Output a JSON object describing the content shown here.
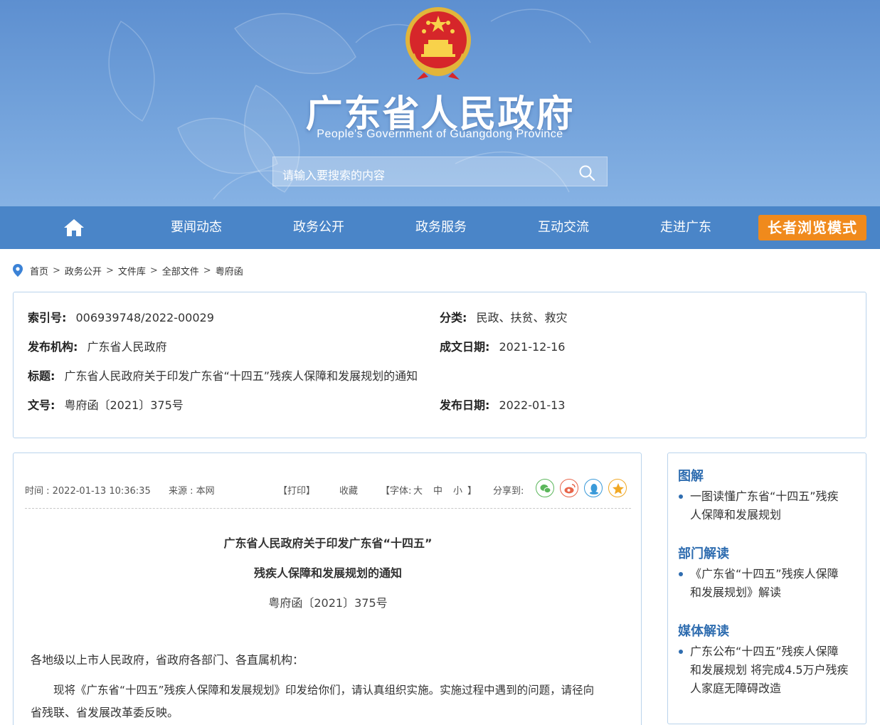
{
  "header": {
    "title": "广东省人民政府",
    "subtitle": "People's Government of Guangdong Province",
    "search_placeholder": "请输入要搜索的内容"
  },
  "nav": {
    "items": [
      "要闻动态",
      "政务公开",
      "政务服务",
      "互动交流",
      "走进广东"
    ],
    "elder_mode": "长者浏览模式"
  },
  "breadcrumb": [
    "首页",
    "政务公开",
    "文件库",
    "全部文件",
    "粤府函"
  ],
  "meta": {
    "index_label": "索引号:",
    "index_value": "006939748/2022-00029",
    "category_label": "分类:",
    "category_value": "民政、扶贫、救灾",
    "publisher_label": "发布机构:",
    "publisher_value": "广东省人民政府",
    "date_written_label": "成文日期:",
    "date_written_value": "2021-12-16",
    "title_label": "标题:",
    "title_value": "广东省人民政府关于印发广东省“十四五”残疾人保障和发展规划的通知",
    "docno_label": "文号:",
    "docno_value": "粤府函〔2021〕375号",
    "publish_date_label": "发布日期:",
    "publish_date_value": "2022-01-13"
  },
  "article": {
    "time": "时间 : 2022-01-13 10:36:35",
    "source": "来源 : 本网",
    "print": "【打印】",
    "favorite": "收藏",
    "font_size_label": "【字体:",
    "font_large": "大",
    "font_medium": "中",
    "font_small": "小",
    "font_close": "】",
    "share_label": "分享到:",
    "title_line1": "广东省人民政府关于印发广东省“十四五”",
    "title_line2": "残疾人保障和发展规划的通知",
    "doc_number": "粤府函〔2021〕375号",
    "salutation": "各地级以上市人民政府，省政府各部门、各直属机构：",
    "body_line1": "现将《广东省“十四五”残疾人保障和发展规划》印发给你们，请认真组织实施。实施过程中遇到的问题，请径向",
    "body_line2": "省残联、省发展改革委反映。"
  },
  "sidebar": {
    "sections": [
      {
        "heading": "图解",
        "items": [
          "一图读懂广东省“十四五”残疾",
          "人保障和发展规划"
        ]
      },
      {
        "heading": "部门解读",
        "items": [
          "《广东省“十四五”残疾人保障",
          "和发展规划》解读"
        ]
      },
      {
        "heading": "媒体解读",
        "items": [
          "广东公布“十四五”残疾人保障",
          "和发展规划 将完成4.5万户残疾",
          "人家庭无障碍改造"
        ]
      }
    ]
  },
  "colors": {
    "header_top": "#5d8fd0",
    "nav_bg": "#4a85c8",
    "elder_button": "#f08a1c",
    "border": "#b9d3ec",
    "accent_blue": "#2f6db0"
  },
  "icons": [
    "national-emblem-icon",
    "search-icon",
    "home-icon",
    "location-pin-icon",
    "wechat-icon",
    "weibo-icon",
    "qq-icon",
    "qzone-icon"
  ]
}
